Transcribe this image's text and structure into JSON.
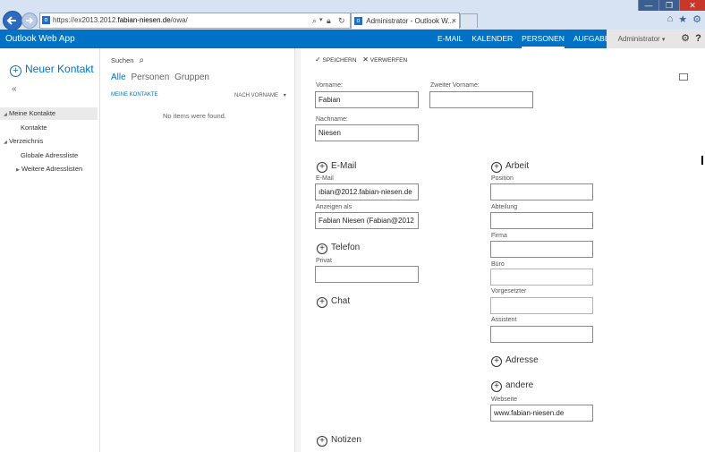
{
  "browser": {
    "url_prefix": "https://ex2013.2012.",
    "url_domain": "fabian-niesen.de",
    "url_path": "/owa/",
    "tab_title": "Administrator - Outlook W...",
    "tab_close": "×",
    "win_controls": [
      "—",
      "❐",
      "✕"
    ]
  },
  "app": {
    "brand": "Outlook Web App",
    "nav": [
      "E-MAIL",
      "KALENDER",
      "PERSONEN",
      "AUFGABEN"
    ],
    "active_nav": "PERSONEN",
    "user": "Administrator",
    "user_caret": "▾",
    "help": "?"
  },
  "leftnav": {
    "new_contact": "Neuer Kontakt",
    "collapse": "«",
    "meine_kontakte": "Meine Kontakte",
    "kontakte": "Kontakte",
    "verzeichnis": "Verzeichnis",
    "globale": "Globale Adressliste",
    "weitere": "Weitere Adresslisten"
  },
  "list": {
    "search_label": "Suchen",
    "filters": [
      "Alle",
      "Personen",
      "Gruppen"
    ],
    "section": "MEINE KONTAKTE",
    "sort": "NACH VORNAME",
    "sort_caret": "▾",
    "empty": "No items were found."
  },
  "form": {
    "save": "SPEICHERN",
    "discard": "VERWERFEN",
    "vorname_label": "Vorname:",
    "vorname": "Fabian",
    "zweiter_label": "Zweiter Vorname:",
    "zweiter": "",
    "nachname_label": "Nachname:",
    "nachname": "Niesen",
    "email_section": "E-Mail",
    "email_label": "E-Mail",
    "email": "ıbian@2012.fabian-niesen.de",
    "anzeigen_label": "Anzeigen als",
    "anzeigen": "Fabian Niesen (Fabian@2012",
    "telefon_section": "Telefon",
    "privat_label": "Privat",
    "privat": "",
    "chat_section": "Chat",
    "notizen_section": "Notizen",
    "arbeit_section": "Arbeit",
    "position_label": "Position",
    "abteilung_label": "Abteilung",
    "firma_label": "Firma",
    "buero_label": "Büro",
    "vorgesetzter_label": "Vorgesetzter",
    "assistent_label": "Assistent",
    "adresse_section": "Adresse",
    "andere_section": "andere",
    "webseite_label": "Webseite",
    "webseite": "www.fabian-niesen.de"
  }
}
